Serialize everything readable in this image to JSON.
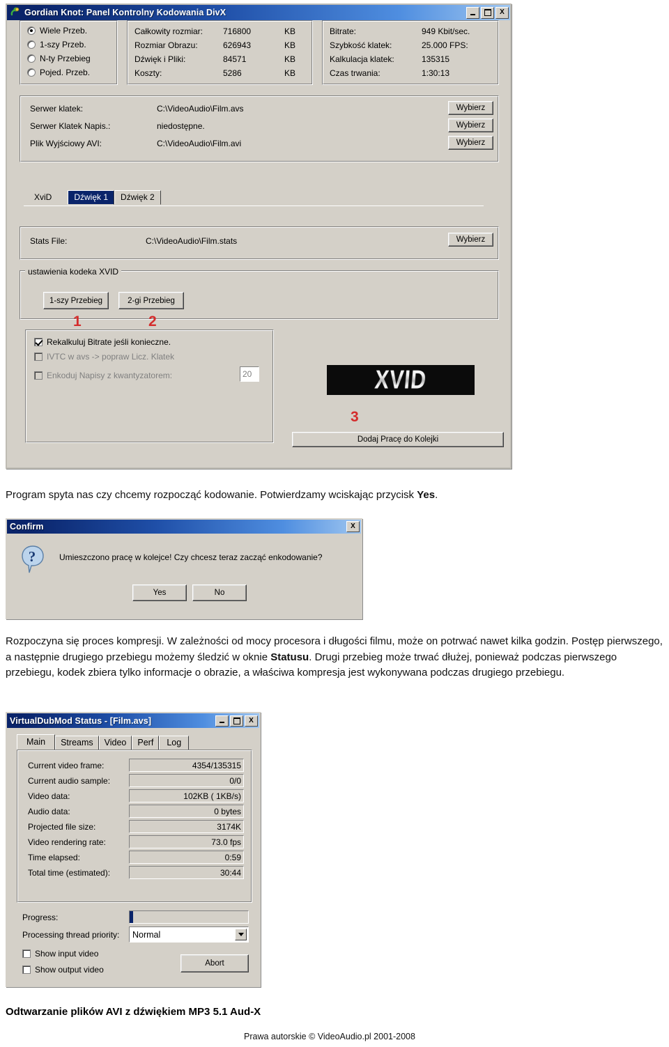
{
  "gordian_window": {
    "title": "Gordian Knot: Panel Kontrolny Kodowania DivX",
    "icon": "gordian-knot-icon",
    "titlebar_buttons": {
      "minimize": "_",
      "maximize": "□",
      "close": "X"
    },
    "passes": {
      "options": [
        {
          "label": "Wiele  Przeb.",
          "selected": true
        },
        {
          "label": "1-szy Przeb.",
          "selected": false
        },
        {
          "label": "N-ty Przebieg",
          "selected": false
        },
        {
          "label": "Pojed. Przeb.",
          "selected": false
        }
      ]
    },
    "size_info": [
      {
        "label": "Całkowity rozmiar:",
        "value": "716800",
        "unit": "KB"
      },
      {
        "label": "Rozmiar Obrazu:",
        "value": "626943",
        "unit": "KB"
      },
      {
        "label": "Dźwięk i Pliki:",
        "value": "84571",
        "unit": "KB"
      },
      {
        "label": "Koszty:",
        "value": "5286",
        "unit": "KB"
      }
    ],
    "stream_info": [
      {
        "label": "Bitrate:",
        "value": "949 Kbit/sec."
      },
      {
        "label": "Szybkość klatek:",
        "value": "25.000 FPS:"
      },
      {
        "label": "Kalkulacja klatek:",
        "value": "135315"
      },
      {
        "label": "Czas trwania:",
        "value": "1:30:13"
      }
    ],
    "files": [
      {
        "label": "Serwer klatek:",
        "value": "C:\\VideoAudio\\Film.avs",
        "button": "Wybierz"
      },
      {
        "label": "Serwer Klatek Napis.:",
        "value": "niedostępne.",
        "button": "Wybierz"
      },
      {
        "label": "Plik Wyjściowy AVI:",
        "value": "C:\\VideoAudio\\Film.avi",
        "button": "Wybierz"
      }
    ],
    "tabs": [
      {
        "label": "XviD",
        "state": "front"
      },
      {
        "label": "Dźwięk 1",
        "state": "highlight"
      },
      {
        "label": "Dźwięk 2",
        "state": "normal"
      }
    ],
    "stats": {
      "label": "Stats File:",
      "value": "C:\\VideoAudio\\Film.stats",
      "button": "Wybierz"
    },
    "codec_group": {
      "legend": "ustawienia kodeka XVID",
      "pass1_button": "1-szy Przebieg",
      "pass2_button": "2-gi Przebieg"
    },
    "checkboxes": [
      {
        "label": "Rekalkuluj Bitrate jeśli konieczne.",
        "checked": true,
        "disabled": false
      },
      {
        "label": "IVTC w avs -> popraw Licz. Klatek",
        "checked": false,
        "disabled": true
      },
      {
        "label": "Enkoduj Napisy z kwantyzatorem:",
        "checked": false,
        "disabled": true
      }
    ],
    "quantizer_value": "20",
    "logo_text": "XVID",
    "queue_button": "Dodaj Pracę do Kolejki",
    "markers": [
      "1",
      "2",
      "3"
    ]
  },
  "text_block_1": {
    "part1": "Program spyta nas czy chcemy rozpocząć kodowanie. Potwierdzamy wciskając przycisk ",
    "bold": "Yes",
    "part2": "."
  },
  "confirm_dialog": {
    "title": "Confirm",
    "close_button": "X",
    "icon": "question-icon",
    "message": "Umieszczono pracę w kolejce! Czy chcesz teraz zacząć enkodowanie?",
    "yes_button": "Yes",
    "no_button": "No"
  },
  "text_block_2": {
    "line1": "Rozpoczyna się proces kompresji. W zależności od mocy procesora i długości filmu, może on potrwać nawet",
    "line2a": "kilka godzin. Postęp pierwszego, a następnie drugiego przebiegu możemy śledzić w oknie ",
    "line2bold": "Statusu",
    "line2b": ".",
    "line3": "Drugi przebieg może trwać dłużej, ponieważ podczas pierwszego przebiegu, kodek zbiera tylko informacje o",
    "line4": "obrazie, a właściwa kompresja jest wykonywana podczas drugiego przebiegu."
  },
  "status_window": {
    "title": "VirtualDubMod Status - [Film.avs]",
    "titlebar_buttons": {
      "minimize": "_",
      "maximize": "□",
      "close": "X"
    },
    "tabs": [
      {
        "label": "Main",
        "selected": true
      },
      {
        "label": "Streams",
        "selected": false
      },
      {
        "label": "Video",
        "selected": false
      },
      {
        "label": "Perf",
        "selected": false
      },
      {
        "label": "Log",
        "selected": false
      }
    ],
    "rows": [
      {
        "label": "Current video frame:",
        "value": "4354/135315"
      },
      {
        "label": "Current audio sample:",
        "value": "0/0"
      },
      {
        "label": "Video data:",
        "value": "102KB (  1KB/s)"
      },
      {
        "label": "Audio data:",
        "value": "0 bytes"
      },
      {
        "label": "Projected file size:",
        "value": "3174K"
      },
      {
        "label": "Video rendering rate:",
        "value": "73.0 fps"
      },
      {
        "label": "Time elapsed:",
        "value": "0:59"
      },
      {
        "label": "Total time (estimated):",
        "value": "30:44"
      }
    ],
    "progress": {
      "label": "Progress:",
      "percent": 3
    },
    "priority": {
      "label": "Processing thread priority:",
      "value": "Normal"
    },
    "show_input": {
      "label": "Show input video",
      "checked": false
    },
    "show_output": {
      "label": "Show output video",
      "checked": false
    },
    "abort_button": "Abort"
  },
  "footer": {
    "heading": "Odtwarzanie plików AVI z dźwiękiem MP3 5.1 Aud-X",
    "copyright": "Prawa autorskie © VideoAudio.pl 2001-2008"
  },
  "colors": {
    "titlebar_start": "#0a246a",
    "titlebar_end": "#9fc6f0",
    "face": "#d4d0c8",
    "marker_red": "#d42c2c",
    "tab_highlight": "#0a246a"
  }
}
